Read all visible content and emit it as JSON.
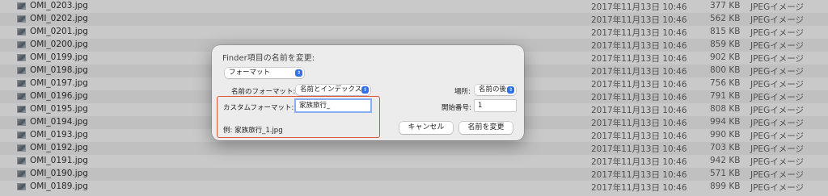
{
  "files": [
    {
      "name": "OMI_0203.jpg",
      "date": "2017年11月13日 10:46",
      "size": "377 KB",
      "kind": "JPEGイメージ"
    },
    {
      "name": "OMI_0202.jpg",
      "date": "2017年11月13日 10:46",
      "size": "562 KB",
      "kind": "JPEGイメージ"
    },
    {
      "name": "OMI_0201.jpg",
      "date": "2017年11月13日 10:46",
      "size": "815 KB",
      "kind": "JPEGイメージ"
    },
    {
      "name": "OMI_0200.jpg",
      "date": "2017年11月13日 10:46",
      "size": "859 KB",
      "kind": "JPEGイメージ"
    },
    {
      "name": "OMI_0199.jpg",
      "date": "2017年11月13日 10:46",
      "size": "902 KB",
      "kind": "JPEGイメージ"
    },
    {
      "name": "OMI_0198.jpg",
      "date": "2017年11月13日 10:46",
      "size": "800 KB",
      "kind": "JPEGイメージ"
    },
    {
      "name": "OMI_0197.jpg",
      "date": "2017年11月13日 10:46",
      "size": "756 KB",
      "kind": "JPEGイメージ"
    },
    {
      "name": "OMI_0196.jpg",
      "date": "2017年11月13日 10:46",
      "size": "791 KB",
      "kind": "JPEGイメージ"
    },
    {
      "name": "OMI_0195.jpg",
      "date": "2017年11月13日 10:46",
      "size": "808 KB",
      "kind": "JPEGイメージ"
    },
    {
      "name": "OMI_0194.jpg",
      "date": "2017年11月13日 10:46",
      "size": "994 KB",
      "kind": "JPEGイメージ"
    },
    {
      "name": "OMI_0193.jpg",
      "date": "2017年11月13日 10:46",
      "size": "990 KB",
      "kind": "JPEGイメージ"
    },
    {
      "name": "OMI_0192.jpg",
      "date": "2017年11月13日 10:46",
      "size": "703 KB",
      "kind": "JPEGイメージ"
    },
    {
      "name": "OMI_0191.jpg",
      "date": "2017年11月13日 10:46",
      "size": "942 KB",
      "kind": "JPEGイメージ"
    },
    {
      "name": "OMI_0190.jpg",
      "date": "2017年11月13日 10:46",
      "size": "571 KB",
      "kind": "JPEGイメージ"
    },
    {
      "name": "OMI_0189.jpg",
      "date": "2017年11月13日 10:46",
      "size": "899 KB",
      "kind": "JPEGイメージ"
    }
  ],
  "dialog": {
    "title": "Finder項目の名前を変更:",
    "mode_select": "フォーマット",
    "name_format_label": "名前のフォーマット:",
    "name_format_select": "名前とインデックス",
    "location_label": "場所:",
    "location_select": "名前の後",
    "custom_format_label": "カスタムフォーマット:",
    "custom_format_value": "家族旅行_",
    "start_number_label": "開始番号:",
    "start_number_value": "1",
    "example_label": "例:",
    "example_value": "家族旅行_1.jpg",
    "cancel_label": "キャンセル",
    "rename_label": "名前を変更"
  },
  "colors": {
    "accent": "#2f6fe8",
    "annotation_box": "#e0533d"
  }
}
